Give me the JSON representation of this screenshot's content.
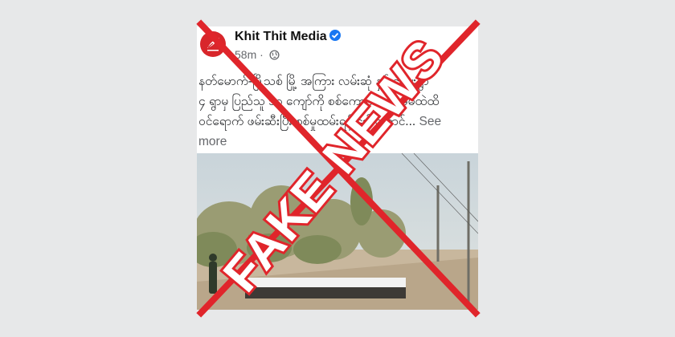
{
  "post": {
    "page_name": "Khit Thit Media",
    "time": "58m",
    "text_lines": [
      "နတ်မောက်-မြို့သစ် မြို့ အကြား လမ်းဆုံ နှင့် ကျေးရွာ",
      "၄ ရွာမှ ပြည်သူ ၁၀ ကျော်ကို စစ်ကောင်စီ နေအိမ်ထဲထိ",
      "ဝင်ရောက် ဖမ်းဆီးပြီး စစ်မှုထမ်းရန် ခေါ်ဆောင်..."
    ],
    "see_more_label": "See",
    "see_more_label_2": "more"
  },
  "stamp": {
    "label": "FAKE NEWS",
    "color": "#e0252b"
  },
  "icons": {
    "avatar": "khit-thit-media-logo",
    "verified": "verified-badge-icon",
    "audience": "globe-icon"
  },
  "colors": {
    "verified": "#1877f2",
    "stamp": "#e0252b",
    "avatar": "#d8262b"
  }
}
